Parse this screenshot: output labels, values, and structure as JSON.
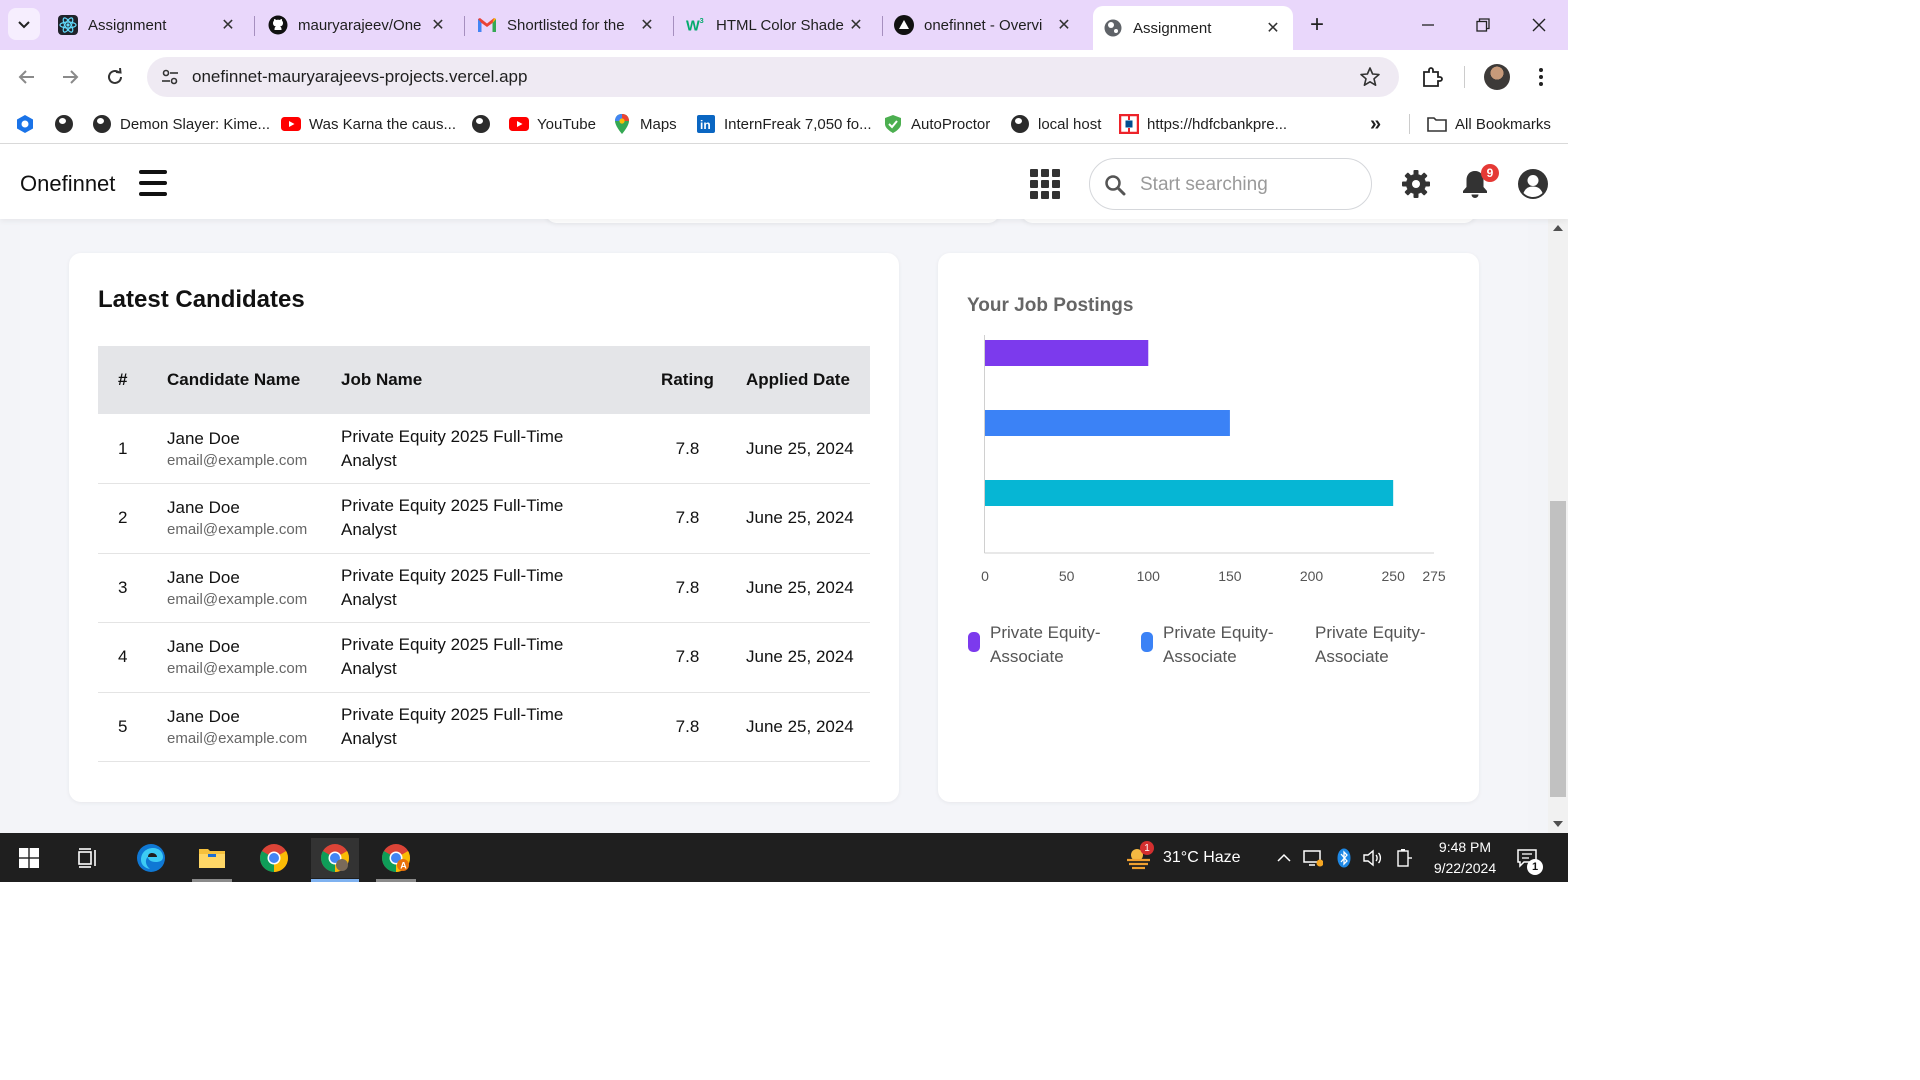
{
  "browser": {
    "tabs": [
      {
        "title": "Assignment",
        "icon": "react-icon",
        "active": false
      },
      {
        "title": "mauryarajeev/One",
        "icon": "github-icon",
        "active": false
      },
      {
        "title": "Shortlisted for the",
        "icon": "gmail-icon",
        "active": false
      },
      {
        "title": "HTML Color Shade",
        "icon": "w3schools-icon",
        "active": false
      },
      {
        "title": "onefinnet - Overvi",
        "icon": "vercel-icon",
        "active": false
      },
      {
        "title": "Assignment",
        "icon": "globe-icon",
        "active": true
      }
    ],
    "url": "onefinnet-mauryarajeevs-projects.vercel.app",
    "bookmarks": [
      {
        "label": "Demon Slayer: Kime...",
        "icon": "globe-icon"
      },
      {
        "label": "Was Karna the caus...",
        "icon": "youtube-icon"
      },
      {
        "label": "YouTube",
        "icon": "youtube-icon"
      },
      {
        "label": "Maps",
        "icon": "maps-icon"
      },
      {
        "label": "InternFreak 7,050 fo...",
        "icon": "linkedin-icon"
      },
      {
        "label": "AutoProctor",
        "icon": "autoproctor-icon"
      },
      {
        "label": "local host",
        "icon": "globe-icon"
      },
      {
        "label": "https://hdfcbankpre...",
        "icon": "hdfc-icon"
      }
    ],
    "all_bookmarks": "All Bookmarks"
  },
  "app": {
    "brand": "Onefinnet",
    "search_placeholder": "Start searching",
    "notification_count": "9"
  },
  "candidates": {
    "title": "Latest Candidates",
    "columns": [
      "#",
      "Candidate Name",
      "Job Name",
      "Rating",
      "Applied Date"
    ],
    "rows": [
      {
        "num": "1",
        "name": "Jane Doe",
        "email": "email@example.com",
        "job": "Private Equity 2025 Full-Time Analyst",
        "rating": "7.8",
        "date": "June 25, 2024"
      },
      {
        "num": "2",
        "name": "Jane Doe",
        "email": "email@example.com",
        "job": "Private Equity 2025 Full-Time Analyst",
        "rating": "7.8",
        "date": "June 25, 2024"
      },
      {
        "num": "3",
        "name": "Jane Doe",
        "email": "email@example.com",
        "job": "Private Equity 2025 Full-Time Analyst",
        "rating": "7.8",
        "date": "June 25, 2024"
      },
      {
        "num": "4",
        "name": "Jane Doe",
        "email": "email@example.com",
        "job": "Private Equity 2025 Full-Time Analyst",
        "rating": "7.8",
        "date": "June 25, 2024"
      },
      {
        "num": "5",
        "name": "Jane Doe",
        "email": "email@example.com",
        "job": "Private Equity 2025 Full-Time Analyst",
        "rating": "7.8",
        "date": "June 25, 2024"
      }
    ]
  },
  "chart_data": {
    "type": "bar",
    "orientation": "horizontal",
    "title": "Your Job Postings",
    "xlim": [
      0,
      275
    ],
    "xticks": [
      0,
      50,
      100,
      150,
      200,
      250,
      275
    ],
    "series": [
      {
        "name": "Private Equity-Associate",
        "value": 100,
        "color": "#7c3aed"
      },
      {
        "name": "Private Equity-Associate",
        "value": 150,
        "color": "#3b82f6"
      },
      {
        "name": "Private Equity-Associate",
        "value": 250,
        "color": "#06b6d4"
      }
    ],
    "legend_position": "bottom"
  },
  "taskbar": {
    "weather": "31°C  Haze",
    "weather_badge": "1",
    "time": "9:48 PM",
    "date": "9/22/2024",
    "notification_badge": "1"
  }
}
